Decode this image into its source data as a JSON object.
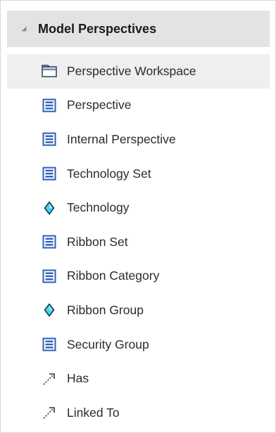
{
  "section": {
    "title": "Model Perspectives",
    "collapse_icon": "triangle-down-icon"
  },
  "items": [
    {
      "label": "Perspective Workspace",
      "icon": "workspace-icon"
    },
    {
      "label": "Perspective",
      "icon": "class-icon"
    },
    {
      "label": "Internal Perspective",
      "icon": "class-icon"
    },
    {
      "label": "Technology Set",
      "icon": "class-icon"
    },
    {
      "label": "Technology",
      "icon": "diamond-icon"
    },
    {
      "label": "Ribbon Set",
      "icon": "class-icon"
    },
    {
      "label": "Ribbon Category",
      "icon": "class-icon"
    },
    {
      "label": "Ribbon Group",
      "icon": "diamond-icon"
    },
    {
      "label": "Security Group",
      "icon": "class-icon"
    },
    {
      "label": "Has",
      "icon": "connector-icon"
    },
    {
      "label": "Linked To",
      "icon": "connector-icon"
    }
  ],
  "colors": {
    "header_bg": "#e3e3e3",
    "highlight_bg": "#efefef",
    "class_icon_blue": "#2f5fb5",
    "diamond_cyan": "#3fd6ea"
  }
}
